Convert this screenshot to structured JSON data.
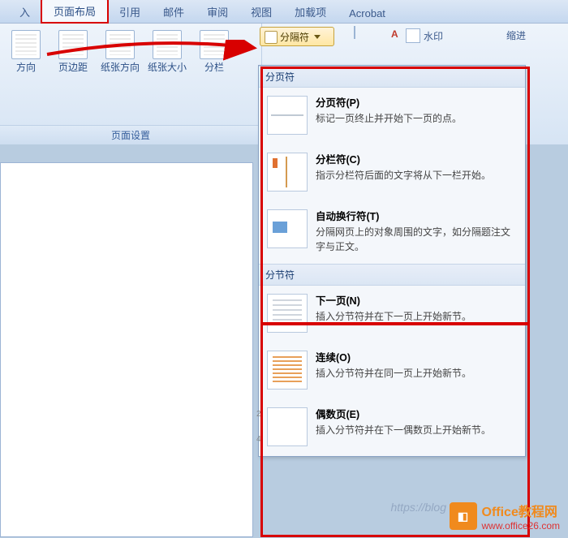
{
  "tabs": {
    "insert_partial": "入",
    "page_layout": "页面布局",
    "references": "引用",
    "mailings": "邮件",
    "review": "审阅",
    "view": "视图",
    "addins": "加载项",
    "acrobat": "Acrobat"
  },
  "ribbon": {
    "btn_orientation": "方向",
    "btn_margins": "页边距",
    "btn_paper_dir": "纸张方向",
    "btn_paper_size": "纸张大小",
    "btn_columns": "分栏",
    "group_pagesetup": "页面设置",
    "breaks_btn": "分隔符",
    "watermark": "水印",
    "indent": "缩进",
    "a_mark": "A"
  },
  "menu": {
    "sec_page": "分页符",
    "i_page_t": "分页符(P)",
    "i_page_d": "标记一页终止并开始下一页的点。",
    "i_col_t": "分栏符(C)",
    "i_col_d": "指示分栏符后面的文字将从下一栏开始。",
    "i_wrap_t": "自动换行符(T)",
    "i_wrap_d": "分隔网页上的对象周围的文字，如分隔题注文字与正文。",
    "sec_section": "分节符",
    "i_next_t": "下一页(N)",
    "i_next_d": "插入分节符并在下一页上开始新节。",
    "i_cont_t": "连续(O)",
    "i_cont_d": "插入分节符并在同一页上开始新节。",
    "i_even_t": "偶数页(E)",
    "i_even_d": "插入分节符并在下一偶数页上开始新节。"
  },
  "watermarks": {
    "blog": "https://blog",
    "brand_t": "Office教程网",
    "brand_u": "www.office26.com"
  }
}
